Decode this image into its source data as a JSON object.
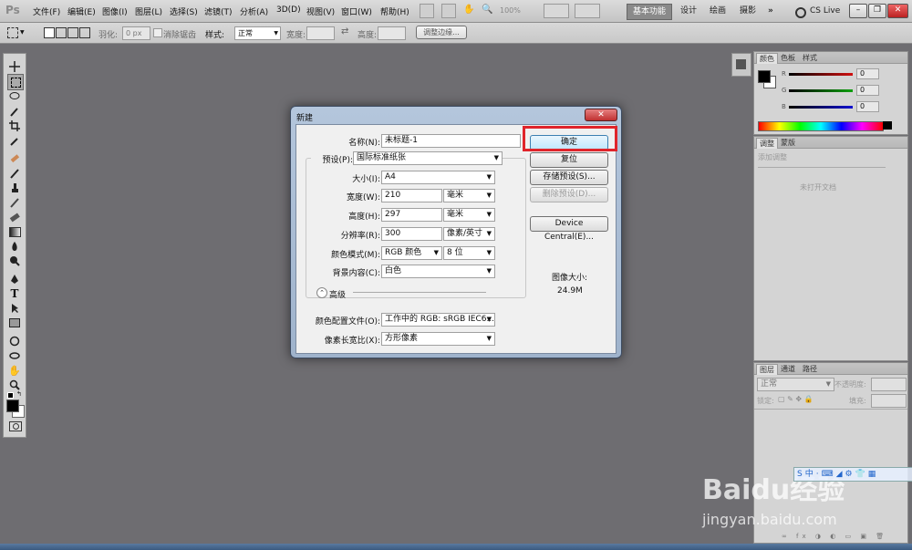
{
  "app": {
    "logo": "Ps"
  },
  "menubar": {
    "items": [
      "文件(F)",
      "编辑(E)",
      "图像(I)",
      "图层(L)",
      "选择(S)",
      "滤镜(T)",
      "分析(A)",
      "3D(D)",
      "视图(V)",
      "窗口(W)",
      "帮助(H)"
    ],
    "zoom": "100%",
    "workspaces": [
      "基本功能",
      "设计",
      "绘画",
      "摄影"
    ],
    "more": "»",
    "cslive": "CS Live",
    "window_buttons": [
      "–",
      "❐",
      "✕"
    ]
  },
  "optionsbar": {
    "feather_label": "羽化:",
    "feather_value": "0 px",
    "antialias_label": "消除锯齿",
    "style_label": "样式:",
    "style_value": "正常",
    "width_label": "宽度:",
    "height_label": "高度:",
    "refine_edge": "调整边缘..."
  },
  "color_panel": {
    "tabs": [
      "颜色",
      "色板",
      "样式"
    ],
    "channels": [
      {
        "name": "R",
        "value": "0",
        "color": "#d01010"
      },
      {
        "name": "G",
        "value": "0",
        "color": "#10a010"
      },
      {
        "name": "B",
        "value": "0",
        "color": "#1010d0"
      }
    ]
  },
  "adjust_panel": {
    "tabs": [
      "调整",
      "蒙版"
    ],
    "header": "添加调整",
    "empty_text": "未打开文档"
  },
  "layers_panel": {
    "tabs": [
      "图层",
      "通道",
      "路径"
    ],
    "blend_mode": "正常",
    "opacity_label": "不透明度:",
    "lock_label": "锁定:",
    "fill_label": "填充:"
  },
  "dialog": {
    "title": "新建",
    "close": "✕",
    "name_label": "名称(N):",
    "name_value": "未标题-1",
    "preset_label": "预设(P):",
    "preset_value": "国际标准纸张",
    "size_label": "大小(I):",
    "size_value": "A4",
    "width_label": "宽度(W):",
    "width_value": "210",
    "width_unit": "毫米",
    "height_label": "高度(H):",
    "height_value": "297",
    "height_unit": "毫米",
    "resolution_label": "分辨率(R):",
    "resolution_value": "300",
    "resolution_unit": "像素/英寸",
    "colormode_label": "颜色模式(M):",
    "colormode_value": "RGB 颜色",
    "bitdepth_value": "8 位",
    "background_label": "背景内容(C):",
    "background_value": "白色",
    "advanced_label": "高级",
    "profile_label": "颜色配置文件(O):",
    "profile_value": "工作中的 RGB: sRGB IEC6...",
    "aspect_label": "像素长宽比(X):",
    "aspect_value": "方形像素",
    "ok_button": "确定",
    "reset_button": "复位",
    "save_preset_button": "存储预设(S)...",
    "delete_preset_button": "删除预设(D)...",
    "device_central_button": "Device Central(E)...",
    "image_size_label": "图像大小:",
    "image_size_value": "24.9M"
  },
  "highlight_color": "#e0242a",
  "watermark": {
    "text": "Baidu经验",
    "url": "jingyan.baidu.com"
  }
}
